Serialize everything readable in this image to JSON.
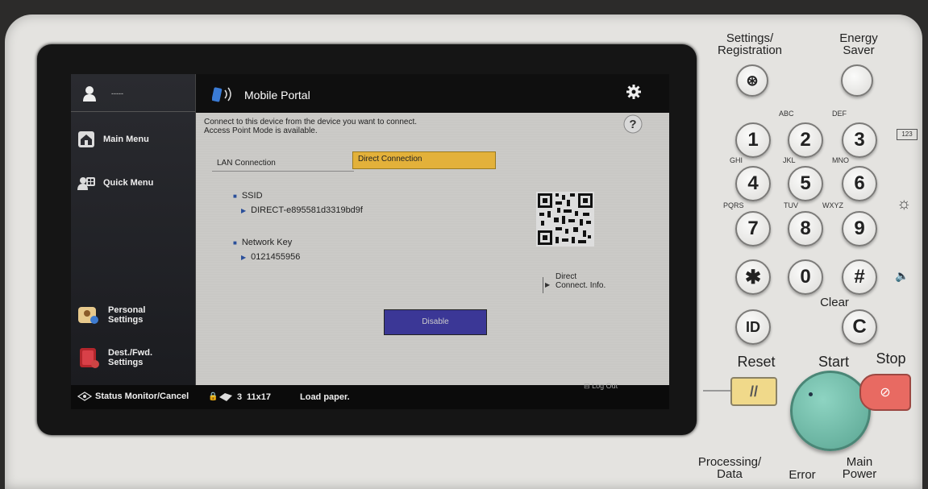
{
  "sidebar": {
    "user_label": "-----",
    "items": [
      {
        "label": "Main Menu"
      },
      {
        "label": "Quick Menu"
      },
      {
        "label": "Personal Settings"
      },
      {
        "label": "Dest./Fwd. Settings"
      }
    ]
  },
  "title": {
    "text": "Mobile Portal"
  },
  "instruction": {
    "line1": "Connect to this device from the device you want to connect.",
    "line2": "Access Point Mode is available."
  },
  "tabs": [
    {
      "label": "LAN Connection",
      "selected": false
    },
    {
      "label": "Direct Connection",
      "selected": true
    }
  ],
  "ssid": {
    "label": "SSID",
    "value": "DIRECT-e895581d3319bd9f"
  },
  "network_key": {
    "label": "Network Key",
    "value": "0121455956"
  },
  "direct_info": {
    "line1": "Direct",
    "line2": "Connect. Info."
  },
  "disable_button": {
    "label": "Disable"
  },
  "status_bar": {
    "monitor_label": "Status Monitor/Cancel",
    "count": "3",
    "paper_size": "11x17",
    "message": "Load paper.",
    "logout": "Log Out"
  },
  "keypad": {
    "settings_label": "Settings/ Registration",
    "energy_label": "Energy Saver",
    "keys": [
      {
        "num": "1",
        "letters": ""
      },
      {
        "num": "2",
        "letters": "ABC"
      },
      {
        "num": "3",
        "letters": "DEF"
      },
      {
        "num": "4",
        "letters": "GHI"
      },
      {
        "num": "5",
        "letters": "JKL"
      },
      {
        "num": "6",
        "letters": "MNO"
      },
      {
        "num": "7",
        "letters": "PQRS"
      },
      {
        "num": "8",
        "letters": "TUV"
      },
      {
        "num": "9",
        "letters": "WXYZ"
      },
      {
        "num": "✱",
        "letters": ""
      },
      {
        "num": "0",
        "letters": ""
      },
      {
        "num": "#",
        "letters": ""
      }
    ],
    "clear_label": "Clear",
    "clear_key": "C",
    "id_key": "ID",
    "reset_label": "Reset",
    "start_label": "Start",
    "stop_label": "Stop",
    "processing_label": "Processing/ Data",
    "error_label": "Error",
    "power_label": "Main Power",
    "counter_icon_text": "123"
  },
  "colors": {
    "selected_tab": "#e3b13a",
    "disable_button": "#3b3796",
    "reset_key": "#f0d98a",
    "start_key": "#6fb6a4",
    "stop_key": "#e86a62"
  }
}
